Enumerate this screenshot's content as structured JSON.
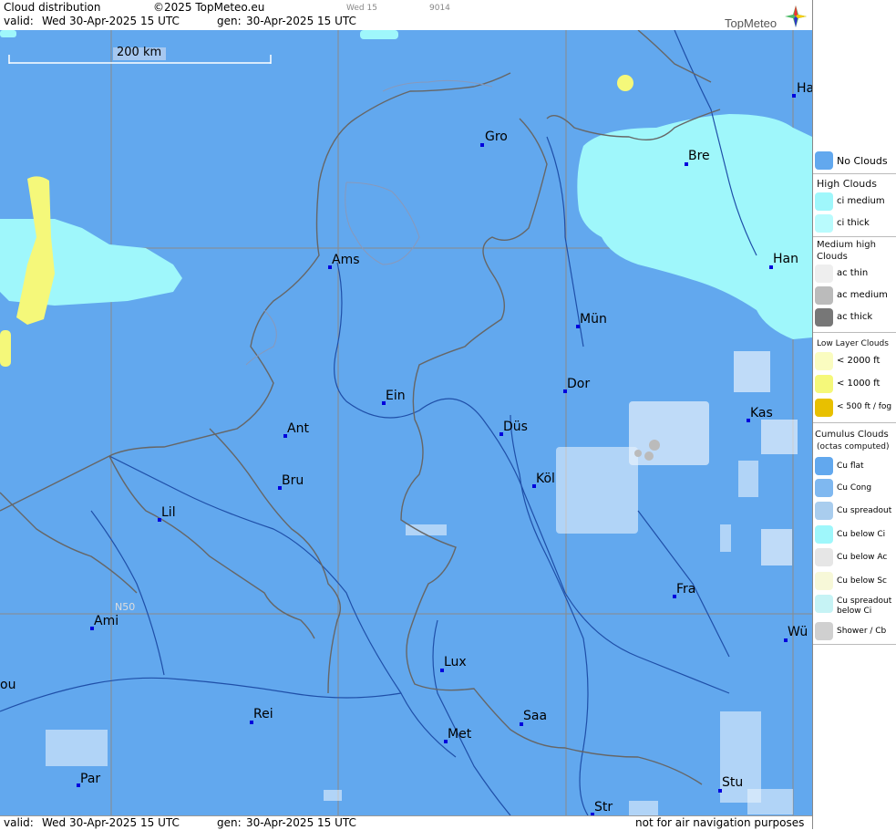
{
  "header": {
    "title": "Cloud distribution",
    "copyright": "©2025 TopMeteo.eu",
    "day_tag": "Wed 15",
    "code_tag": "9014",
    "valid_label": "valid:",
    "valid_value": "Wed  30-Apr-2025  15 UTC",
    "gen_label": "gen:",
    "gen_value": "30-Apr-2025 15 UTC",
    "brand": "TopMeteo"
  },
  "scale": {
    "label": "200 km"
  },
  "grid": {
    "lat_label": "N50"
  },
  "cities": [
    {
      "name": "Gro"
    },
    {
      "name": "Bre"
    },
    {
      "name": "Ha"
    },
    {
      "name": "Ams"
    },
    {
      "name": "Han"
    },
    {
      "name": "Mün"
    },
    {
      "name": "Ein"
    },
    {
      "name": "Dor"
    },
    {
      "name": "Kas"
    },
    {
      "name": "Ant"
    },
    {
      "name": "Düs"
    },
    {
      "name": "Köl"
    },
    {
      "name": "Bru"
    },
    {
      "name": "Lil"
    },
    {
      "name": "Fra"
    },
    {
      "name": "Ami"
    },
    {
      "name": "Wü"
    },
    {
      "name": "Lux"
    },
    {
      "name": "ou"
    },
    {
      "name": "Rei"
    },
    {
      "name": "Saa"
    },
    {
      "name": "Met"
    },
    {
      "name": "Par"
    },
    {
      "name": "Stu"
    },
    {
      "name": "Str"
    }
  ],
  "legend": {
    "no_clouds": "No Clouds",
    "high_head": "High Clouds",
    "ci_medium": "ci medium",
    "ci_thick": "ci thick",
    "medium_head": "Medium high Clouds",
    "ac_thin": "ac thin",
    "ac_medium": "ac medium",
    "ac_thick": "ac thick",
    "low_head": "Low Layer Clouds",
    "low_2000": "< 2000 ft",
    "low_1000": "< 1000 ft",
    "low_500": "< 500 ft / fog",
    "cu_head": "Cumulus Clouds",
    "cu_sub": "(octas computed)",
    "cu_flat": "Cu flat",
    "cu_cong": "Cu Cong",
    "cu_spread": "Cu spreadout",
    "cu_below_ci": "Cu below Ci",
    "cu_below_ac": "Cu below Ac",
    "cu_below_sc": "Cu below Sc",
    "cu_spread_ci": "Cu spreadout below Ci",
    "shower": "Shower / Cb"
  },
  "footer": {
    "valid_label": "valid:",
    "valid_value": "Wed  30-Apr-2025  15 UTC",
    "gen_label": "gen:",
    "gen_value": "30-Apr-2025 15 UTC",
    "disclaimer": "not for air navigation purposes"
  },
  "colors": {
    "sea_land": "#62a8ee",
    "ci_medium": "#9ff7fb",
    "low_1000": "#f5f87a",
    "fog": "#e8c000",
    "border": "#666666",
    "river": "#1f4fa8",
    "city_dot": "#0000dd"
  }
}
